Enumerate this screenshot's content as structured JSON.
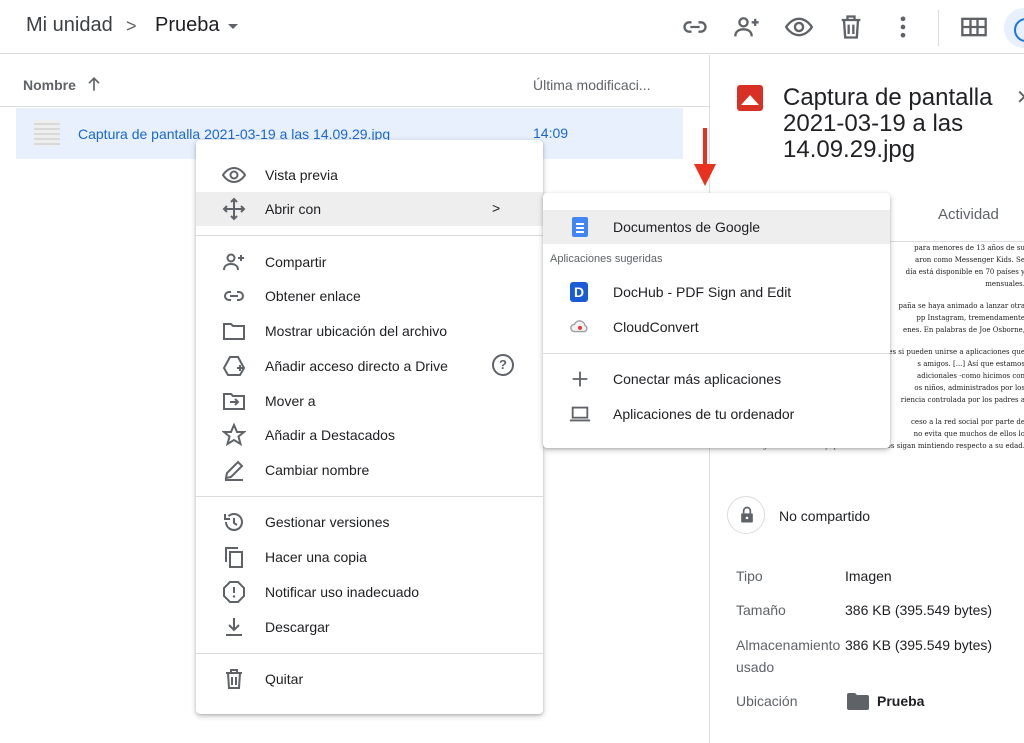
{
  "header": {
    "breadcrumb_root": "Mi unidad",
    "breadcrumb_separator": ">",
    "breadcrumb_folder": "Prueba",
    "toolbar_icons": [
      "link-icon",
      "share-person-icon",
      "eye-icon",
      "trash-icon",
      "more-vert-icon",
      "grid-view-icon",
      "info-icon"
    ]
  },
  "list": {
    "col_name": "Nombre",
    "col_modified": "Última modificaci...",
    "files": [
      {
        "name": "Captura de pantalla 2021-03-19 a las 14.09.29.jpg",
        "modified": "14:09"
      }
    ]
  },
  "context_menu": {
    "items": [
      {
        "label": "Vista previa",
        "icon": "eye-icon"
      },
      {
        "label": "Abrir con",
        "icon": "move-arrows-icon",
        "submenu_indicator": ">"
      },
      {
        "label": "Compartir",
        "icon": "person-add-icon"
      },
      {
        "label": "Obtener enlace",
        "icon": "link-icon"
      },
      {
        "label": "Mostrar ubicación del archivo",
        "icon": "folder-icon"
      },
      {
        "label": "Añadir acceso directo a Drive",
        "icon": "drive-shortcut-icon",
        "help": "?"
      },
      {
        "label": "Mover a",
        "icon": "move-to-folder-icon"
      },
      {
        "label": "Añadir a Destacados",
        "icon": "star-icon"
      },
      {
        "label": "Cambiar nombre",
        "icon": "pencil-icon"
      },
      {
        "label": "Gestionar versiones",
        "icon": "history-icon"
      },
      {
        "label": "Hacer una copia",
        "icon": "copy-icon"
      },
      {
        "label": "Notificar uso inadecuado",
        "icon": "report-icon"
      },
      {
        "label": "Descargar",
        "icon": "download-icon"
      },
      {
        "label": "Quitar",
        "icon": "trash-icon"
      }
    ]
  },
  "submenu": {
    "top_item": "Documentos de Google",
    "suggested_heading": "Aplicaciones sugeridas",
    "suggested": [
      "DocHub - PDF Sign and Edit",
      "CloudConvert"
    ],
    "connect_more": "Conectar más aplicaciones",
    "computer_apps": "Aplicaciones de tu ordenador"
  },
  "details": {
    "title": "Captura de pantalla 2021-03-19 a las 14.09.29.jpg",
    "activity_tab": "Actividad",
    "preview_lines": [
      "para menores de 13 años de su",
      "aron como Messenger Kids. Se",
      "día está disponible en 70 países y",
      "mensuales.",
      "paña se haya animado a lanzar otra",
      "pp Instagram, tremendamente",
      "enes. En palabras de Joe Osborne,",
      "es si pueden unirse a aplicaciones que",
      "s amigos. [...] Así que estamos",
      "adicionales -como hicimos con",
      "os niños, administrados por los",
      "riencia controlada por los padres a",
      "ceso a la red social por parte de",
      "no evita que muchos de ellos lo",
      "sigan intentando... y que otros muchos sigan mintiendo respecto a su edad."
    ],
    "sharing_status": "No compartido",
    "type_label": "Tipo",
    "type_value": "Imagen",
    "size_label": "Tamaño",
    "size_value": "386 KB (395.549 bytes)",
    "storage_label_1": "Almacenamiento",
    "storage_label_2": "usado",
    "storage_value": "386 KB (395.549 bytes)",
    "location_label": "Ubicación",
    "location_value": "Prueba"
  },
  "colors": {
    "accent": "#1a73e8",
    "selected_row": "#e8f0fe",
    "annotation_arrow": "#e8311f"
  }
}
